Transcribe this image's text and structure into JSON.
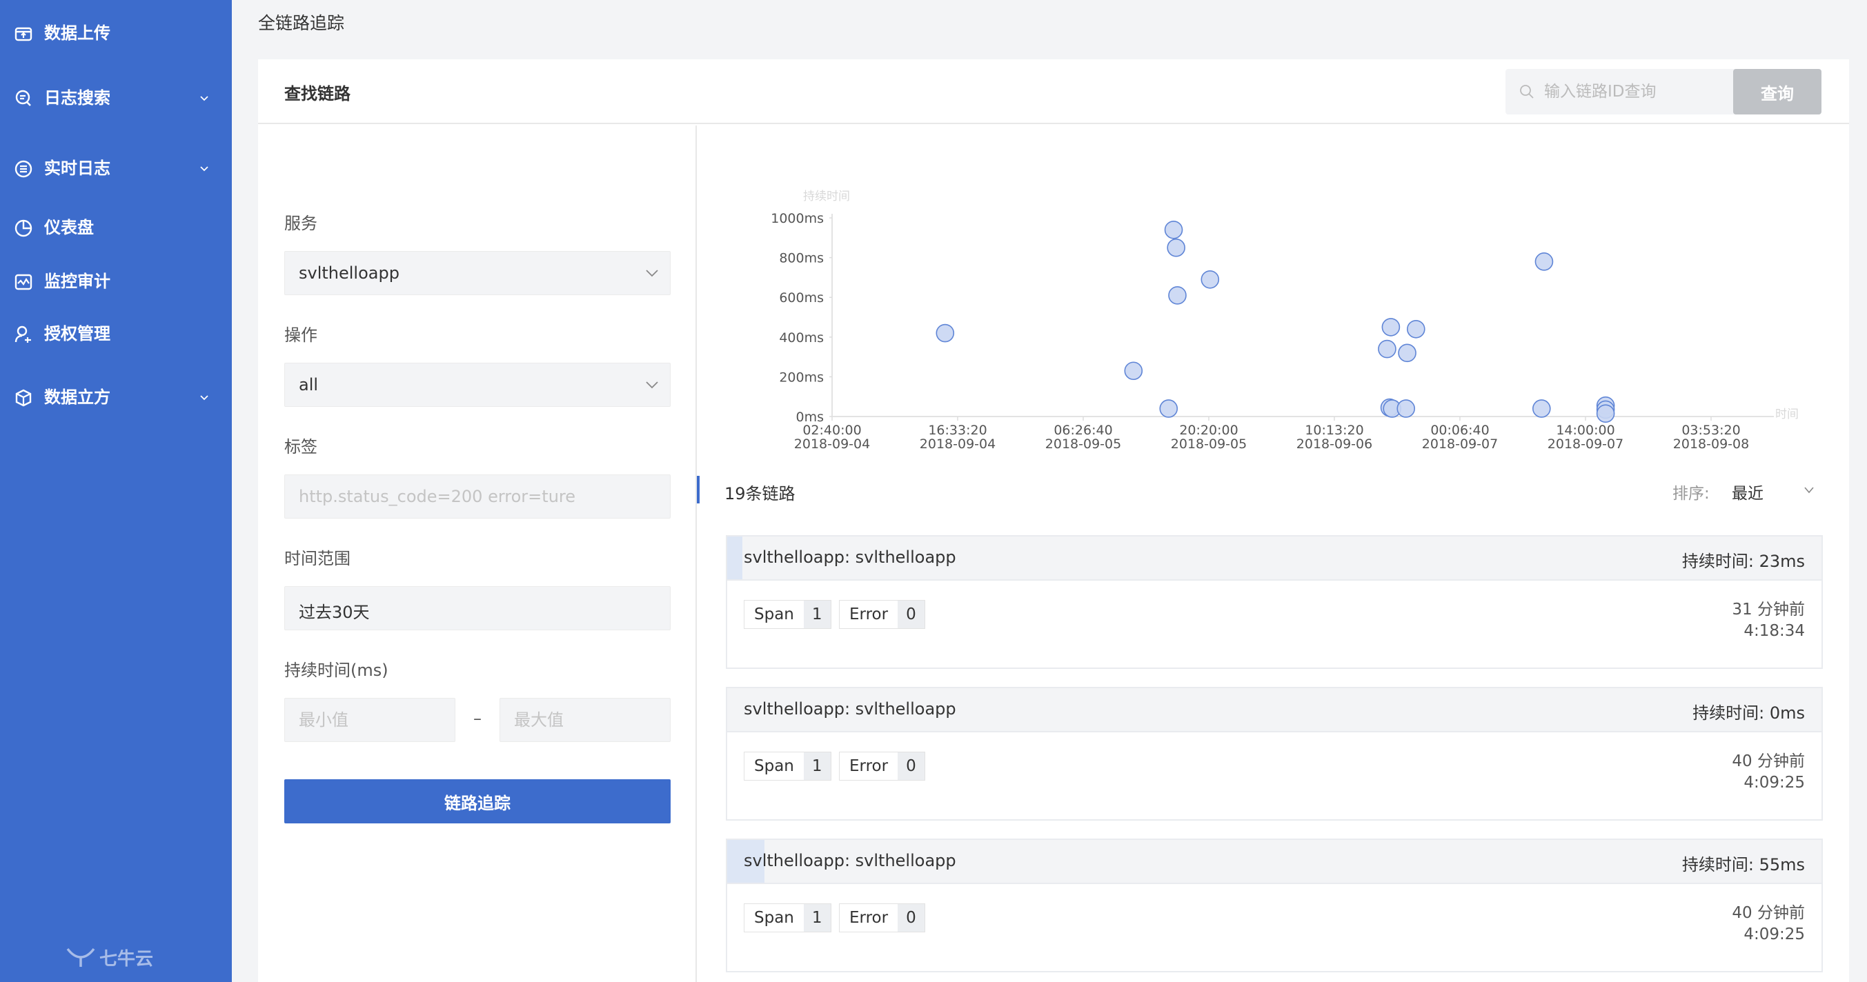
{
  "sidebar": {
    "items": [
      {
        "label": "数据上传",
        "icon": "upload-icon",
        "has_children": false
      },
      {
        "label": "日志搜索",
        "icon": "log-search-icon",
        "has_children": true
      },
      {
        "label": "实时日志",
        "icon": "realtime-log-icon",
        "has_children": true
      },
      {
        "label": "仪表盘",
        "icon": "dashboard-icon",
        "has_children": false
      },
      {
        "label": "监控审计",
        "icon": "monitor-icon",
        "has_children": false
      },
      {
        "label": "授权管理",
        "icon": "auth-user-icon",
        "has_children": false
      },
      {
        "label": "数据立方",
        "icon": "cube-icon",
        "has_children": true
      }
    ],
    "logo_text": "七牛云"
  },
  "page": {
    "title": "全链路追踪"
  },
  "header": {
    "title": "查找链路",
    "search_placeholder": "输入链路ID查询",
    "query_label": "查询"
  },
  "form": {
    "service_label": "服务",
    "service_value": "svlthelloapp",
    "operation_label": "操作",
    "operation_value": "all",
    "tags_label": "标签",
    "tags_placeholder": "http.status_code=200 error=ture",
    "time_range_label": "时间范围",
    "time_range_value": "过去30天",
    "duration_label": "持续时间(ms)",
    "min_placeholder": "最小值",
    "max_placeholder": "最大值",
    "range_dash": "–",
    "submit_label": "链路追踪"
  },
  "colors": {
    "primary": "#3d6ccc",
    "point_fill": "#c9d6f3",
    "point_stroke": "#5f85d6"
  },
  "chart_data": {
    "type": "scatter",
    "ylabel": "持续时间",
    "xlabel": "时间",
    "ylim": [
      0,
      1000
    ],
    "y_ticks": [
      "0ms",
      "200ms",
      "400ms",
      "600ms",
      "800ms",
      "1000ms"
    ],
    "x_ticks": [
      {
        "time": "02:40:00",
        "date": "2018-09-04"
      },
      {
        "time": "16:33:20",
        "date": "2018-09-04"
      },
      {
        "time": "06:26:40",
        "date": "2018-09-05"
      },
      {
        "time": "20:20:00",
        "date": "2018-09-05"
      },
      {
        "time": "10:13:20",
        "date": "2018-09-06"
      },
      {
        "time": "00:06:40",
        "date": "2018-09-07"
      },
      {
        "time": "14:00:00",
        "date": "2018-09-07"
      },
      {
        "time": "03:53:20",
        "date": "2018-09-08"
      }
    ],
    "points": [
      {
        "x": 0.9,
        "y": 420
      },
      {
        "x": 2.4,
        "y": 230
      },
      {
        "x": 2.68,
        "y": 40
      },
      {
        "x": 2.72,
        "y": 940
      },
      {
        "x": 2.74,
        "y": 850
      },
      {
        "x": 2.75,
        "y": 610
      },
      {
        "x": 3.01,
        "y": 690
      },
      {
        "x": 4.42,
        "y": 340
      },
      {
        "x": 4.44,
        "y": 45
      },
      {
        "x": 4.45,
        "y": 450
      },
      {
        "x": 4.46,
        "y": 40
      },
      {
        "x": 4.57,
        "y": 40
      },
      {
        "x": 4.58,
        "y": 320
      },
      {
        "x": 4.65,
        "y": 440
      },
      {
        "x": 5.67,
        "y": 780
      },
      {
        "x": 5.65,
        "y": 40
      },
      {
        "x": 6.16,
        "y": 55
      },
      {
        "x": 6.16,
        "y": 35
      },
      {
        "x": 6.16,
        "y": 15
      }
    ]
  },
  "results": {
    "count_label": "19条链路",
    "sort_label": "排序:",
    "sort_value": "最近"
  },
  "traces": [
    {
      "name": "svlthelloapp: svlthelloapp",
      "duration": "持续时间:  23ms",
      "span_label": "Span",
      "span_count": "1",
      "error_label": "Error",
      "error_count": "0",
      "ago": "31 分钟前",
      "time": "4:18:34",
      "bar_fraction": 0.014
    },
    {
      "name": "svlthelloapp: svlthelloapp",
      "duration": "持续时间:  0ms",
      "span_label": "Span",
      "span_count": "1",
      "error_label": "Error",
      "error_count": "0",
      "ago": "40 分钟前",
      "time": "4:09:25",
      "bar_fraction": 0.0
    },
    {
      "name": "svlthelloapp: svlthelloapp",
      "duration": "持续时间:  55ms",
      "span_label": "Span",
      "span_count": "1",
      "error_label": "Error",
      "error_count": "0",
      "ago": "40 分钟前",
      "time": "4:09:25",
      "bar_fraction": 0.034
    }
  ]
}
